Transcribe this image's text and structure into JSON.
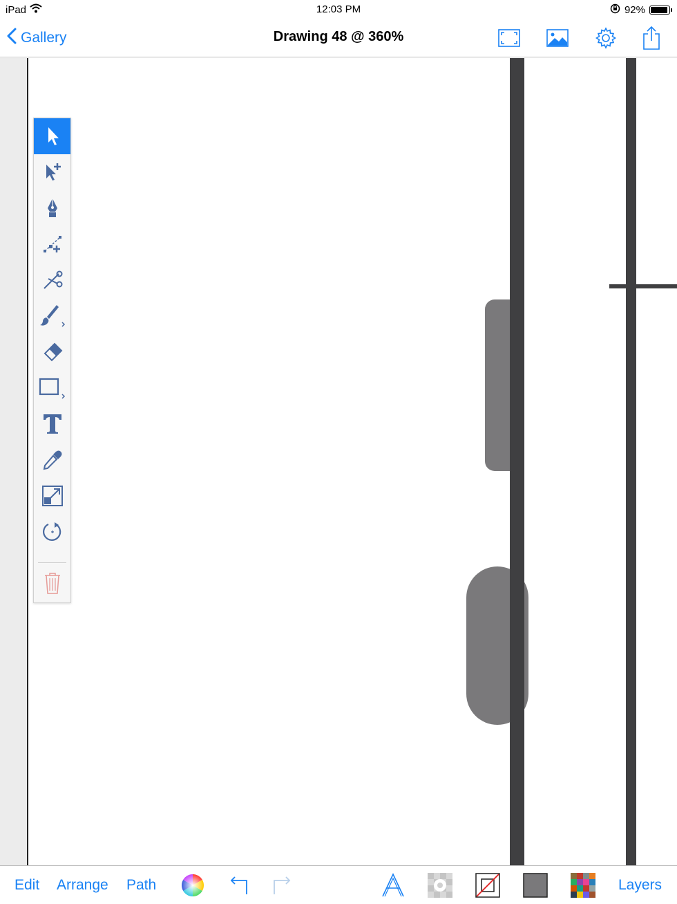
{
  "status_bar": {
    "device": "iPad",
    "time": "12:03 PM",
    "battery": "92%",
    "battery_level": 0.92
  },
  "nav": {
    "back_label": "Gallery",
    "title": "Drawing 48 @ 360%"
  },
  "bottom_bar": {
    "edit_label": "Edit",
    "arrange_label": "Arrange",
    "path_label": "Path",
    "layers_label": "Layers"
  },
  "tools": [
    {
      "name": "select-icon",
      "active": true
    },
    {
      "name": "node-select-icon",
      "active": false
    },
    {
      "name": "pen-icon",
      "active": false
    },
    {
      "name": "add-node-icon",
      "active": false
    },
    {
      "name": "scissors-icon",
      "active": false
    },
    {
      "name": "brush-icon",
      "active": false
    },
    {
      "name": "eraser-icon",
      "active": false
    },
    {
      "name": "rectangle-icon",
      "active": false
    },
    {
      "name": "text-icon",
      "active": false
    },
    {
      "name": "eyedropper-icon",
      "active": false
    },
    {
      "name": "scale-icon",
      "active": false
    },
    {
      "name": "rotate-icon",
      "active": false
    },
    {
      "name": "trash-icon",
      "active": false
    }
  ],
  "colors": {
    "accent": "#1a82f4",
    "tool_icon": "#4a6aa0",
    "stroke_dark": "#3f3f41",
    "shape_gray": "#7a797b",
    "trash": "#e69a96"
  }
}
